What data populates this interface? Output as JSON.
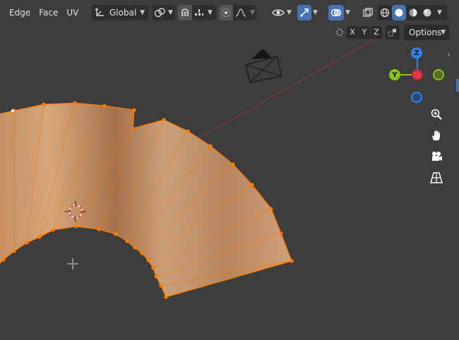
{
  "header": {
    "menus": [
      "Edge",
      "Face",
      "UV"
    ],
    "transform_orientation": "Global"
  },
  "axis_toggles": [
    "X",
    "Y",
    "Z"
  ],
  "options_label": "Options",
  "gizmo": {
    "z_label": "Z",
    "y_label": "Y",
    "x_label": "",
    "colors": {
      "x": "#e2394c",
      "y": "#8ac219",
      "z": "#2f84e3"
    }
  },
  "icons": {
    "transform_orientation": "orientation-axes-icon",
    "pivot": "pivot-point-icon",
    "snap": "magnet-snap-icon",
    "snap_target": "snap-increment-icon",
    "proportional": "proportional-edit-icon",
    "falloff": "falloff-curve-icon",
    "visibility": "eye-icon",
    "gizmo_toggle": "gizmo-arrow-icon",
    "overlay": "overlay-circles-icon",
    "xray": "xray-icon",
    "shading": [
      "wireframe-shading-icon",
      "solid-shading-icon",
      "material-shading-icon",
      "rendered-shading-icon"
    ],
    "nav": [
      "zoom-icon",
      "hand-pan-icon",
      "camera-icon",
      "grid-perspective-icon"
    ]
  },
  "mesh": {
    "selection_color": "#ff7a00",
    "face_color": "#c9956a"
  }
}
